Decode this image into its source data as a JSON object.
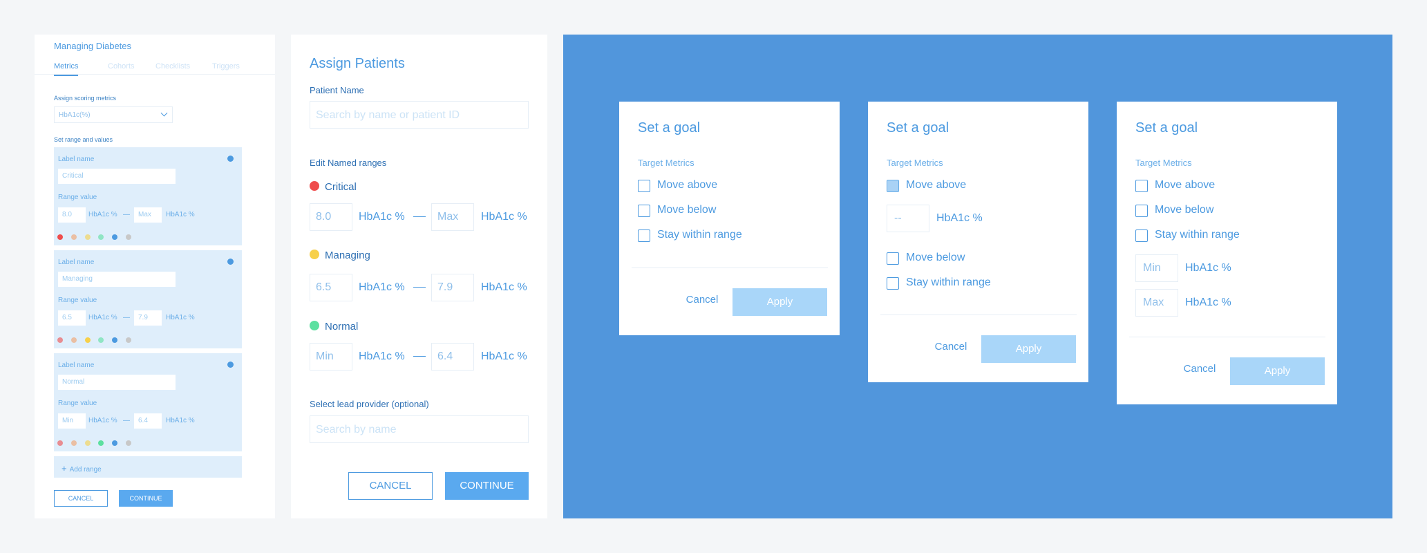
{
  "panel1": {
    "title": "Managing Diabetes",
    "tabs": [
      "Metrics",
      "Cohorts",
      "Checklists",
      "Triggers"
    ],
    "assign_label": "Assign scoring metrics",
    "metric_select": "HbA1c(%)",
    "range_label": "Set range and values",
    "card_label_name": "Label name",
    "card_range_value": "Range value",
    "unit": "HbA1c %",
    "dash": "—",
    "ranges": [
      {
        "name": "Critical",
        "min": "8.0",
        "max": "Max"
      },
      {
        "name": "Managing",
        "min": "6.5",
        "max": "7.9"
      },
      {
        "name": "Normal",
        "min": "Min",
        "max": "6.4"
      }
    ],
    "dot_colors": [
      "#ef4c4c",
      "#f2a06b",
      "#f7d04a",
      "#5ce0a0",
      "#4c9ae0",
      "#c8c8c8"
    ],
    "add_range": "Add range",
    "cancel": "CANCEL",
    "continue": "CONTINUE"
  },
  "panel2": {
    "title": "Assign Patients",
    "patient_name_label": "Patient Name",
    "patient_search_placeholder": "Search by name or patient ID",
    "named_ranges_label": "Edit Named ranges",
    "unit": "HbA1c %",
    "ranges": [
      {
        "name": "Critical",
        "color": "#ef4c4c",
        "min": "8.0",
        "max": "Max"
      },
      {
        "name": "Managing",
        "color": "#f7d04a",
        "min": "6.5",
        "max": "7.9"
      },
      {
        "name": "Normal",
        "color": "#5ce0a0",
        "min": "Min",
        "max": "6.4"
      }
    ],
    "provider_label": "Select lead provider (optional)",
    "provider_placeholder": "Search by name",
    "cancel": "CANCEL",
    "continue": "CONTINUE"
  },
  "panel3": {
    "goal_title": "Set a goal",
    "target_metrics": "Target Metrics",
    "options": [
      "Move above",
      "Move below",
      "Stay within range"
    ],
    "unit": "HbA1c %",
    "dialog2_input": "--",
    "dialog3_min": "Min",
    "dialog3_max": "Max",
    "cancel": "Cancel",
    "apply": "Apply"
  }
}
